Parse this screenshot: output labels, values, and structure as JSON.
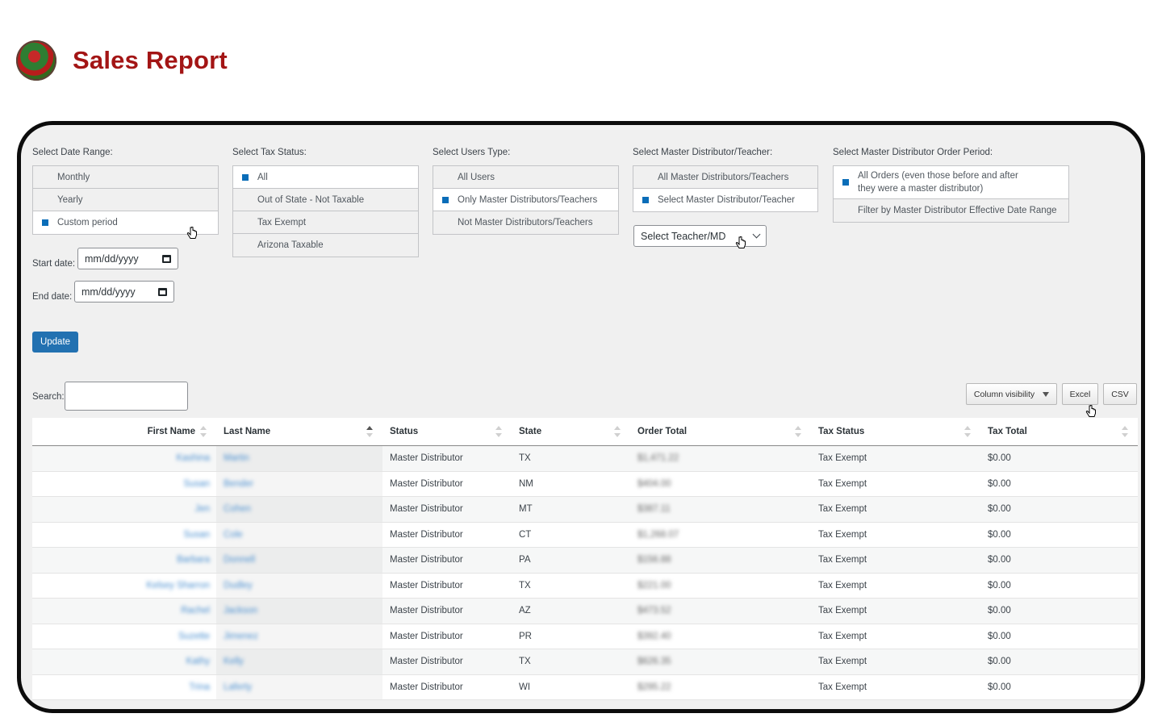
{
  "page": {
    "title": "Sales Report"
  },
  "filters": {
    "date_range": {
      "label": "Select Date Range:",
      "options": [
        "Monthly",
        "Yearly",
        "Custom period"
      ],
      "start_label": "Start date:",
      "start_placeholder": "mm/dd/yyyy",
      "end_label": "End date:",
      "end_placeholder": "mm/dd/yyyy"
    },
    "tax_status": {
      "label": "Select Tax Status:",
      "options": [
        "All",
        "Out of State - Not Taxable",
        "Tax Exempt",
        "Arizona Taxable"
      ]
    },
    "users_type": {
      "label": "Select Users Type:",
      "options": [
        "All Users",
        "Only Master Distributors/Teachers",
        "Not Master Distributors/Teachers"
      ]
    },
    "master_distributor": {
      "label": "Select Master Distributor/Teacher:",
      "options": [
        "All Master Distributors/Teachers",
        "Select Master Distributor/Teacher"
      ],
      "select_value": "Select Teacher/MD"
    },
    "order_period": {
      "label": "Select Master Distributor Order Period:",
      "options": [
        "All Orders (even those before and after they were a master distributor)",
        "Filter by Master Distributor Effective Date Range"
      ]
    },
    "update_label": "Update"
  },
  "table_controls": {
    "search_label": "Search:",
    "column_visibility": "Column visibility",
    "excel": "Excel",
    "csv": "CSV"
  },
  "table": {
    "columns": [
      "First Name",
      "Last Name",
      "Status",
      "State",
      "Order Total",
      "Tax Status",
      "Tax Total"
    ],
    "rows": [
      [
        "Kashina",
        "Martin",
        "Master Distributor",
        "TX",
        "$1,471.22",
        "Tax Exempt",
        "$0.00"
      ],
      [
        "Susan",
        "Bender",
        "Master Distributor",
        "NM",
        "$404.00",
        "Tax Exempt",
        "$0.00"
      ],
      [
        "Jen",
        "Cohen",
        "Master Distributor",
        "MT",
        "$387.11",
        "Tax Exempt",
        "$0.00"
      ],
      [
        "Susan",
        "Cole",
        "Master Distributor",
        "CT",
        "$1,268.07",
        "Tax Exempt",
        "$0.00"
      ],
      [
        "Barbara",
        "Donnell",
        "Master Distributor",
        "PA",
        "$156.88",
        "Tax Exempt",
        "$0.00"
      ],
      [
        "Kelsey Sharron",
        "Dudley",
        "Master Distributor",
        "TX",
        "$221.00",
        "Tax Exempt",
        "$0.00"
      ],
      [
        "Rachel",
        "Jackson",
        "Master Distributor",
        "AZ",
        "$473.52",
        "Tax Exempt",
        "$0.00"
      ],
      [
        "Suzette",
        "Jimenez",
        "Master Distributor",
        "PR",
        "$392.40",
        "Tax Exempt",
        "$0.00"
      ],
      [
        "Kathy",
        "Kelly",
        "Master Distributor",
        "TX",
        "$626.35",
        "Tax Exempt",
        "$0.00"
      ],
      [
        "Trina",
        "Laferty",
        "Master Distributor",
        "WI",
        "$295.22",
        "Tax Exempt",
        "$0.00"
      ]
    ]
  }
}
